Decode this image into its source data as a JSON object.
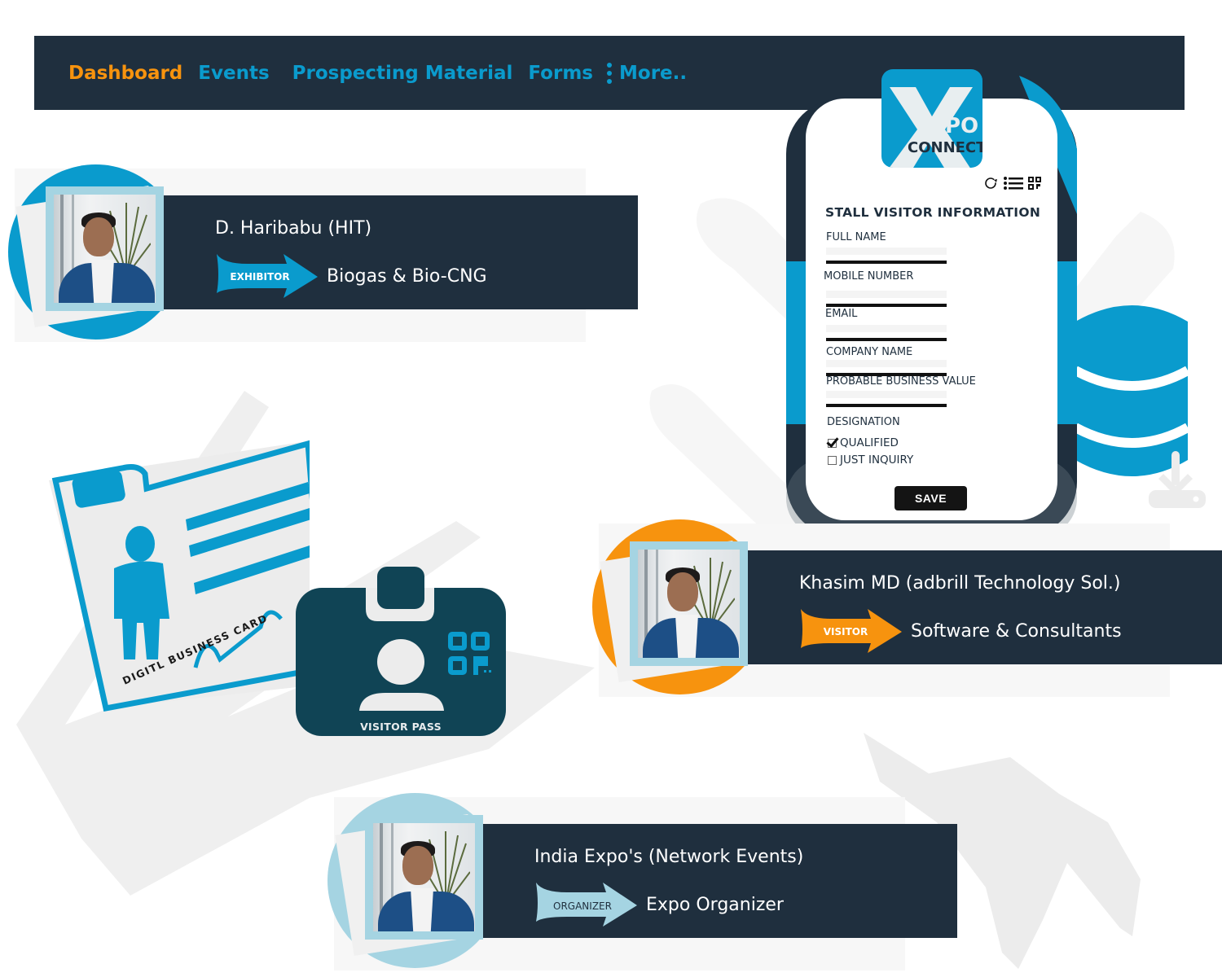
{
  "nav": {
    "items": [
      {
        "label": "Dashboard",
        "active": true
      },
      {
        "label": "Events",
        "active": false
      },
      {
        "label": "Prospecting Material",
        "active": false
      },
      {
        "label": "Forms",
        "active": false
      }
    ],
    "more_label": "More..",
    "more_icon": "vertical-dots-icon"
  },
  "colors": {
    "navy": "#1f2f3e",
    "accent_blue": "#0a9bcd",
    "accent_orange": "#f7930e",
    "light_blue": "#a5d4e2",
    "pass_teal": "#104455"
  },
  "profiles": [
    {
      "name": "D. Haribabu (HIT)",
      "role": "EXHIBITOR",
      "industry": "Biogas & Bio-CNG",
      "color": "#0a9bcd"
    },
    {
      "name": "Khasim MD (adbrill Technology Sol.)",
      "role": "VISITOR",
      "industry": "Software & Consultants",
      "color": "#f7930e"
    },
    {
      "name": "India Expo's (Network Events)",
      "role": "ORGANIZER",
      "industry": "Expo Organizer",
      "color": "#a5d4e2"
    }
  ],
  "phone": {
    "logo": {
      "main": "X",
      "suffix": "PO",
      "sub": "CONNECT"
    },
    "tool_icons": [
      "refresh-icon",
      "list-icon",
      "qr-code-icon"
    ],
    "form": {
      "title": "STALL VISITOR INFORMATION",
      "fields": [
        {
          "label": "FULL NAME",
          "value": "",
          "placeholder": ""
        },
        {
          "label": "MOBILE NUMBER",
          "value": "",
          "placeholder": ""
        },
        {
          "label": "EMAIL",
          "value": "",
          "placeholder": ""
        },
        {
          "label": "COMPANY NAME",
          "value": "",
          "placeholder": ""
        },
        {
          "label": "PROBABLE BUSINESS VALUE",
          "value": "",
          "placeholder": ""
        }
      ],
      "designation_label": "DESIGNATION",
      "options": [
        {
          "label": "QUALIFIED",
          "checked": true
        },
        {
          "label": "JUST INQUIRY",
          "checked": false
        }
      ],
      "save_label": "SAVE"
    }
  },
  "illustrations": {
    "business_card_label": "DIGITL BUSINESS CARD",
    "visitor_pass_label": "VISITOR PASS"
  }
}
